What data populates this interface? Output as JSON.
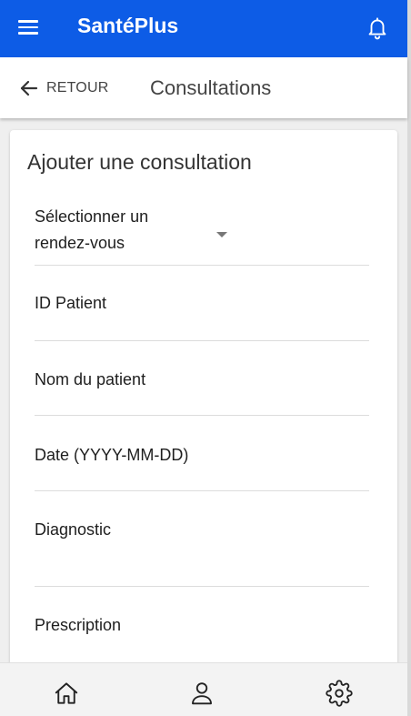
{
  "app": {
    "brand": "SantéPlus"
  },
  "header": {
    "back_label": "RETOUR",
    "title": "Consultations"
  },
  "form": {
    "title": "Ajouter une consultation",
    "appointment_select": {
      "placeholder": "Sélectionner un rendez-vous"
    },
    "fields": {
      "patient_id": "ID Patient",
      "patient_name": "Nom du patient",
      "date": "Date (YYYY-MM-DD)",
      "diagnostic": "Diagnostic",
      "prescription": "Prescription"
    }
  },
  "bottom_nav": {
    "items": [
      "home-icon",
      "profile-icon",
      "settings-icon"
    ]
  },
  "colors": {
    "primary": "#0d5ce6",
    "surface": "#ffffff",
    "background": "#efefef"
  },
  "icons": {
    "menu": "hamburger-icon",
    "notifications": "bell-icon",
    "back": "arrow-left-icon"
  }
}
